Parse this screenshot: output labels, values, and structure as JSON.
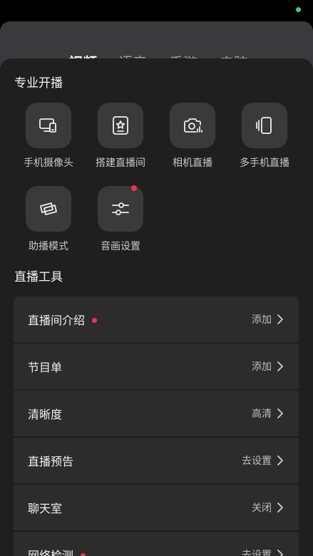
{
  "background": {
    "tabs": [
      "视频",
      "语音",
      "手游",
      "电脑"
    ]
  },
  "section_pro": {
    "title": "专业开播",
    "items": [
      {
        "label": "手机摄像头",
        "icon": "phone-camera-icon"
      },
      {
        "label": "搭建直播间",
        "icon": "build-room-icon"
      },
      {
        "label": "相机直播",
        "icon": "camera-live-icon"
      },
      {
        "label": "多手机直播",
        "icon": "multi-phone-icon"
      },
      {
        "label": "助播模式",
        "icon": "assist-mode-icon"
      },
      {
        "label": "音画设置",
        "icon": "sliders-icon",
        "badge": true
      }
    ]
  },
  "section_tools": {
    "title": "直播工具",
    "rows": [
      {
        "label": "直播间介绍",
        "value": "添加",
        "dot": true
      },
      {
        "label": "节目单",
        "value": "添加"
      },
      {
        "label": "清晰度",
        "value": "高清"
      },
      {
        "label": "直播预告",
        "value": "去设置"
      },
      {
        "label": "聊天室",
        "value": "关闭"
      },
      {
        "label": "网络检测",
        "value": "去设置",
        "dot": true
      }
    ]
  },
  "colors": {
    "panel_bg": "#1f1f1f",
    "card_bg": "#2c2c2c",
    "icon_bg": "#3a3a3a",
    "accent_red": "#fe2c55",
    "status_green": "#35d07f"
  }
}
